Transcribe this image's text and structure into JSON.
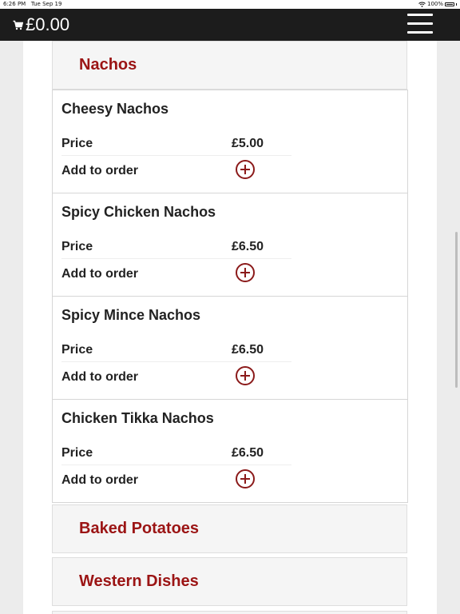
{
  "status_bar": {
    "time": "6:26 PM",
    "date": "Tue Sep 19",
    "battery": "100%",
    "wifi_icon": "wifi-icon"
  },
  "header": {
    "cart_icon": "cart-icon",
    "cart_total": "£0.00",
    "menu_icon": "hamburger-menu-icon"
  },
  "categories": {
    "nachos": "Nachos",
    "baked_potatoes": "Baked Potatoes",
    "western_dishes": "Western Dishes"
  },
  "labels": {
    "price": "Price",
    "add_to_order": "Add to order"
  },
  "items": [
    {
      "name": "Cheesy Nachos",
      "price": "£5.00"
    },
    {
      "name": "Spicy Chicken Nachos",
      "price": "£6.50"
    },
    {
      "name": "Spicy Mince Nachos",
      "price": "£6.50"
    },
    {
      "name": "Chicken Tikka Nachos",
      "price": "£6.50"
    }
  ],
  "colors": {
    "accent": "#9b1414",
    "topbar": "#1c1c1c"
  }
}
